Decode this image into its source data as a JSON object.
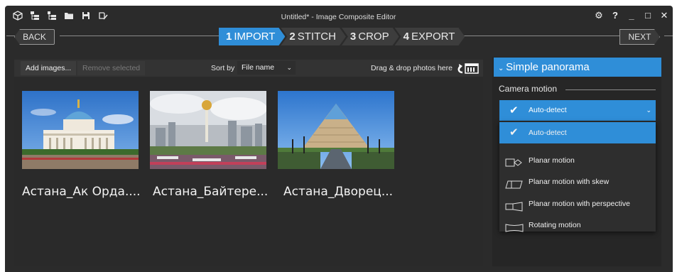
{
  "window": {
    "title": "Untitled* - Image Composite Editor",
    "toolbar_icons": [
      "cube-icon",
      "tree-icon",
      "tree-add-icon",
      "folder-icon",
      "save-icon",
      "save-as-icon"
    ],
    "controls": {
      "settings": "⚙",
      "help": "?",
      "minimize": "_",
      "maximize": "□",
      "close": "✕"
    }
  },
  "nav": {
    "back": "BACK",
    "next": "NEXT",
    "steps": [
      {
        "num": "1",
        "label": "IMPORT",
        "active": true
      },
      {
        "num": "2",
        "label": "STITCH",
        "active": false
      },
      {
        "num": "3",
        "label": "CROP",
        "active": false
      },
      {
        "num": "4",
        "label": "EXPORT",
        "active": false
      }
    ]
  },
  "import_toolbar": {
    "add_images": "Add images...",
    "remove_selected": "Remove selected",
    "sort_by_label": "Sort by",
    "sort_value": "File name",
    "drag_drop": "Drag & drop photos here"
  },
  "thumbnails": [
    {
      "caption": "Астана_Ак Орда...."
    },
    {
      "caption": "Астана_Байтере..."
    },
    {
      "caption": "Астана_Дворец..."
    }
  ],
  "panel": {
    "header": "Simple panorama",
    "camera_motion_label": "Camera motion",
    "selected": "Auto-detect",
    "options": [
      {
        "label": "Auto-detect",
        "icon": "check-icon",
        "selected": true
      },
      {
        "label": "Planar motion",
        "icon": "planar-motion-icon",
        "selected": false
      },
      {
        "label": "Planar motion with skew",
        "icon": "planar-skew-icon",
        "selected": false
      },
      {
        "label": "Planar motion with perspective",
        "icon": "planar-perspective-icon",
        "selected": false
      },
      {
        "label": "Rotating motion",
        "icon": "rotating-motion-icon",
        "selected": false
      }
    ]
  },
  "colors": {
    "accent": "#2f8ed8",
    "background": "#2b2b2b"
  }
}
